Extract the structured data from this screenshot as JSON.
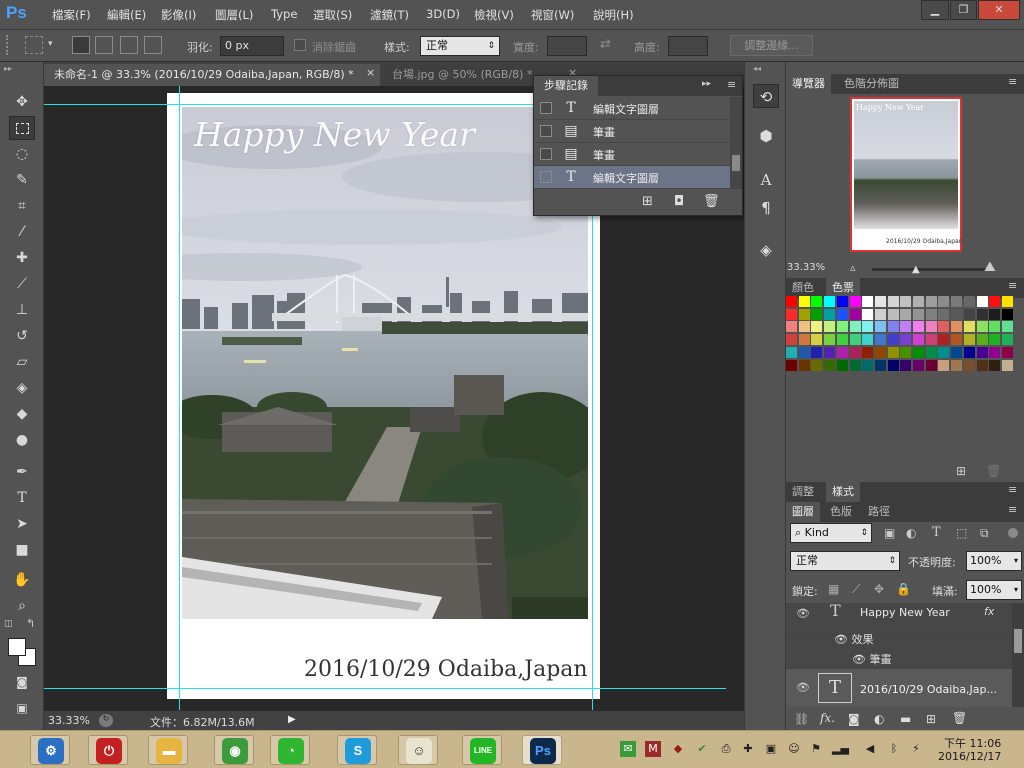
{
  "app": {
    "logo": "Ps",
    "menus": [
      "檔案(F)",
      "編輯(E)",
      "影像(I)",
      "圖層(L)",
      "Type",
      "選取(S)",
      "濾鏡(T)",
      "3D(D)",
      "檢視(V)",
      "視窗(W)",
      "說明(H)"
    ],
    "window_buttons": {
      "minimize": "▁",
      "restore": "❐",
      "close": "✕"
    }
  },
  "options": {
    "feather_label": "羽化:",
    "feather_value": "0 px",
    "antialias_label": "消除鋸齒",
    "style_label": "樣式:",
    "style_value": "正常",
    "width_label": "寬度:",
    "height_label": "高度:",
    "refine_button": "調整邊緣..."
  },
  "doc_tabs": [
    {
      "label": "未命名-1 @ 33.3% (2016/10/29   Odaiba,Japan, RGB/8) *",
      "close": "×",
      "active": true
    },
    {
      "label": "台場.jpg @ 50% (RGB/8) *",
      "close": "×",
      "active": false
    }
  ],
  "artwork": {
    "heading": "Happy New Year",
    "caption": "2016/10/29   Odaiba,Japan"
  },
  "status": {
    "zoom": "33.33%",
    "doc_size": "文件：6.82M/13.6M"
  },
  "history": {
    "title": "步驟記錄",
    "rows": [
      {
        "icon": "T",
        "label": "編輯文字圖層",
        "selected": false
      },
      {
        "icon": "▤",
        "label": "筆畫",
        "selected": false
      },
      {
        "icon": "▤",
        "label": "筆畫",
        "selected": false
      },
      {
        "icon": "T",
        "label": "編輯文字圖層",
        "selected": true
      }
    ]
  },
  "navigator": {
    "tabs": [
      "導覽器",
      "色階分佈圖"
    ],
    "zoom": "33.33%",
    "thumb_heading": "Happy New Year",
    "thumb_caption": "2016/10/29   Odaiba,Japan"
  },
  "swatches": {
    "tabs": [
      "顏色",
      "色票"
    ]
  },
  "adjust": {
    "tabs": [
      "調整",
      "樣式"
    ]
  },
  "layers": {
    "tabs": [
      "圖層",
      "色版",
      "路徑"
    ],
    "kind_label": "Kind",
    "blend_mode": "正常",
    "opacity_label": "不透明度:",
    "opacity_value": "100%",
    "lock_label": "鎖定:",
    "fill_label": "填滿:",
    "fill_value": "100%",
    "items": [
      {
        "name": "Happy New Year",
        "fx": "fx"
      },
      {
        "name": "效果"
      },
      {
        "name": "筆畫"
      },
      {
        "name": "2016/10/29   Odaiba,Jap..."
      }
    ]
  },
  "taskbar": {
    "apps": [
      {
        "name": "control-panel",
        "glyph": "⚙",
        "color": "#2a6fc4"
      },
      {
        "name": "power",
        "glyph": "⏻",
        "color": "#c42020"
      },
      {
        "name": "file-explorer",
        "glyph": "▬",
        "color": "#e7b440"
      },
      {
        "name": "chrome",
        "glyph": "◉",
        "color": "#3c9b3c"
      },
      {
        "name": "wechat",
        "glyph": "◔",
        "color": "#2fb52f"
      },
      {
        "name": "skype",
        "glyph": "S",
        "color": "#1e9bdb"
      },
      {
        "name": "mascot",
        "glyph": "☺",
        "color": "#e9e4d0"
      },
      {
        "name": "line",
        "glyph": "LINE",
        "color": "#22b722"
      },
      {
        "name": "photoshop",
        "glyph": "Ps",
        "color": "#0d2a4d"
      }
    ],
    "time": "下午 11:06",
    "date": "2016/12/17"
  }
}
